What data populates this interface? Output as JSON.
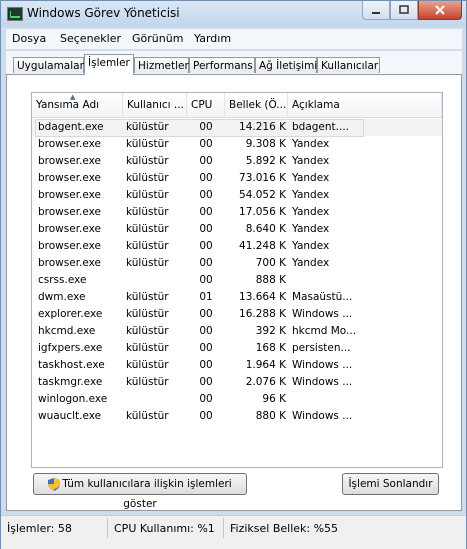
{
  "window": {
    "title": "Windows Görev Yöneticisi"
  },
  "menu": [
    "Dosya",
    "Seçenekler",
    "Görünüm",
    "Yardım"
  ],
  "tabs": [
    "Uygulamalar",
    "İşlemler",
    "Hizmetler",
    "Performans",
    "Ağ İletişimi",
    "Kullanıcılar"
  ],
  "active_tab": "İşlemler",
  "columns": {
    "name": "Yansıma Adı",
    "user": "Kullanıcı ...",
    "cpu": "CPU",
    "memory": "Bellek (Ö...",
    "description": "Açıklama"
  },
  "processes": [
    {
      "name": "bdagent.exe",
      "user": "külüstür",
      "cpu": "00",
      "memory": "14.216 K",
      "desc": "bdagent...."
    },
    {
      "name": "browser.exe",
      "user": "külüstür",
      "cpu": "00",
      "memory": "9.308 K",
      "desc": "Yandex"
    },
    {
      "name": "browser.exe",
      "user": "külüstür",
      "cpu": "00",
      "memory": "5.892 K",
      "desc": "Yandex"
    },
    {
      "name": "browser.exe",
      "user": "külüstür",
      "cpu": "00",
      "memory": "73.016 K",
      "desc": "Yandex"
    },
    {
      "name": "browser.exe",
      "user": "külüstür",
      "cpu": "00",
      "memory": "54.052 K",
      "desc": "Yandex"
    },
    {
      "name": "browser.exe",
      "user": "külüstür",
      "cpu": "00",
      "memory": "17.056 K",
      "desc": "Yandex"
    },
    {
      "name": "browser.exe",
      "user": "külüstür",
      "cpu": "00",
      "memory": "8.640 K",
      "desc": "Yandex"
    },
    {
      "name": "browser.exe",
      "user": "külüstür",
      "cpu": "00",
      "memory": "41.248 K",
      "desc": "Yandex"
    },
    {
      "name": "browser.exe",
      "user": "külüstür",
      "cpu": "00",
      "memory": "700 K",
      "desc": "Yandex"
    },
    {
      "name": "csrss.exe",
      "user": "",
      "cpu": "00",
      "memory": "888 K",
      "desc": ""
    },
    {
      "name": "dwm.exe",
      "user": "külüstür",
      "cpu": "01",
      "memory": "13.664 K",
      "desc": "Masaüstü..."
    },
    {
      "name": "explorer.exe",
      "user": "külüstür",
      "cpu": "00",
      "memory": "16.288 K",
      "desc": "Windows ..."
    },
    {
      "name": "hkcmd.exe",
      "user": "külüstür",
      "cpu": "00",
      "memory": "392 K",
      "desc": "hkcmd Mo..."
    },
    {
      "name": "igfxpers.exe",
      "user": "külüstür",
      "cpu": "00",
      "memory": "168 K",
      "desc": "persisten..."
    },
    {
      "name": "taskhost.exe",
      "user": "külüstür",
      "cpu": "00",
      "memory": "1.964 K",
      "desc": "Windows ..."
    },
    {
      "name": "taskmgr.exe",
      "user": "külüstür",
      "cpu": "00",
      "memory": "2.076 K",
      "desc": "Windows ..."
    },
    {
      "name": "winlogon.exe",
      "user": "",
      "cpu": "00",
      "memory": "96 K",
      "desc": ""
    },
    {
      "name": "wuauclt.exe",
      "user": "külüstür",
      "cpu": "00",
      "memory": "880 K",
      "desc": "Windows ..."
    }
  ],
  "buttons": {
    "show_all": "Tüm kullanıcılara ilişkin işlemleri göster",
    "end_process": "İşlemi Sonlandır"
  },
  "status": {
    "processes": "İşlemler: 58",
    "cpu": "CPU Kullanımı: %1",
    "memory": "Fiziksel Bellek: %55"
  }
}
